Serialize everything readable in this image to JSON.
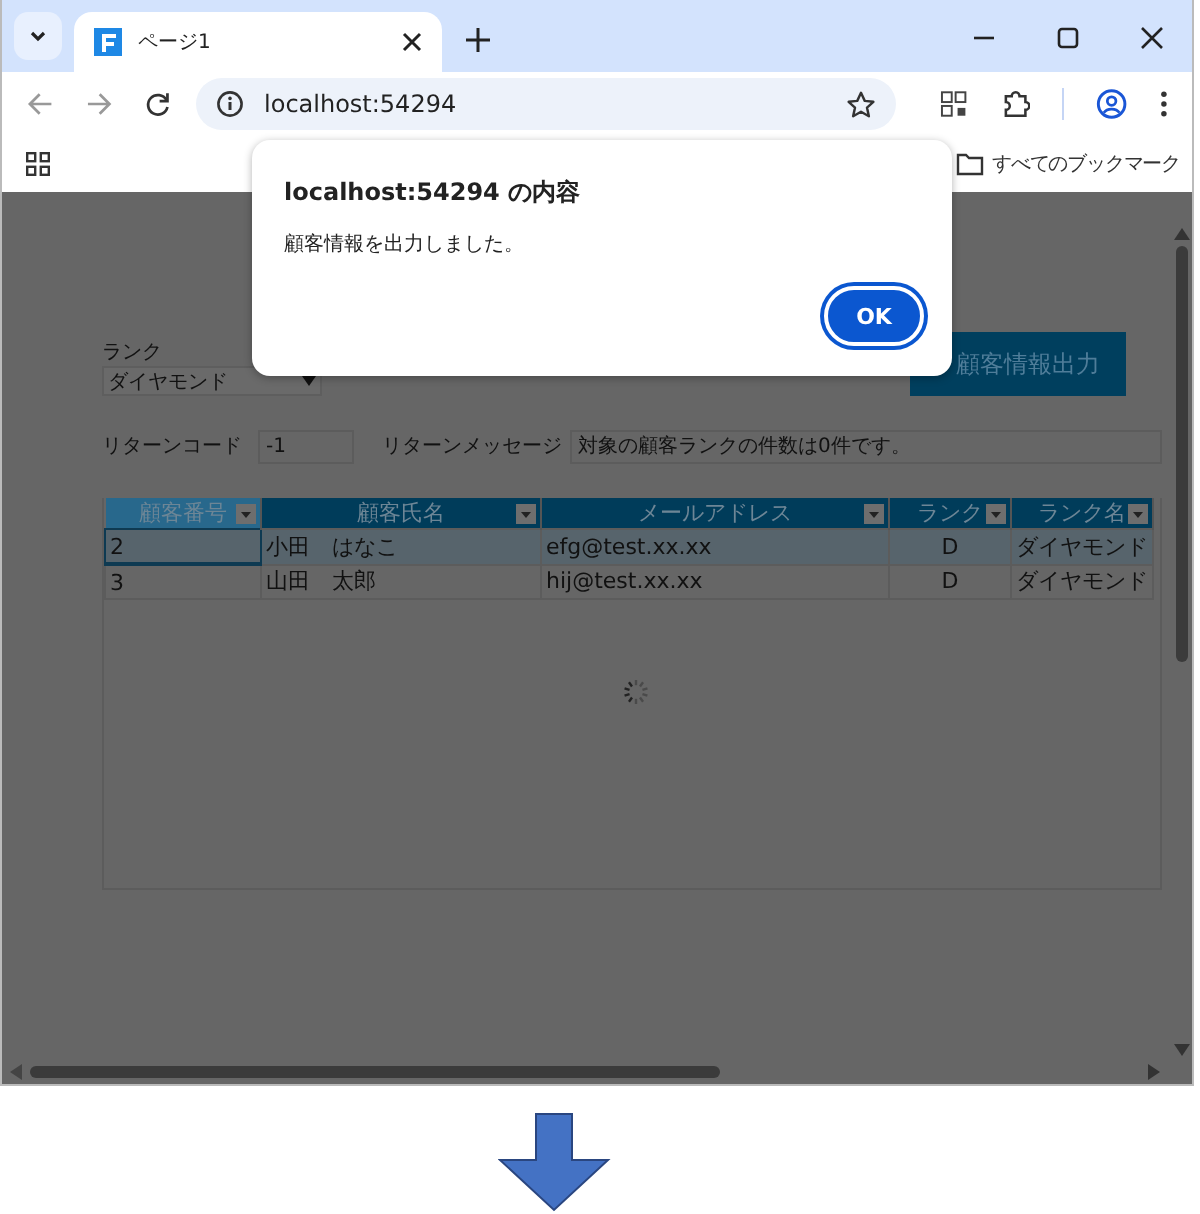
{
  "browser": {
    "tabs": [
      {
        "title": "ページ1",
        "selected": true
      }
    ],
    "address": "localhost:54294",
    "bookmarks": [
      {
        "label": "すべてのブックマーク"
      }
    ]
  },
  "page": {
    "rank": {
      "label": "ランク",
      "value": "ダイヤモンド"
    },
    "export_button": "顧客情報出力",
    "return_code": {
      "label": "リターンコード",
      "value": "-1"
    },
    "return_message": {
      "label": "リターンメッセージ",
      "value": "対象の顧客ランクの件数は0件です。"
    },
    "table": {
      "columns": [
        {
          "label": "顧客番号",
          "selected": true
        },
        {
          "label": "顧客氏名",
          "selected": false
        },
        {
          "label": "メールアドレス",
          "selected": false
        },
        {
          "label": "ランク",
          "selected": false
        },
        {
          "label": "ランク名",
          "selected": false
        }
      ],
      "rows": [
        {
          "cells": [
            "2",
            "小田　はなこ",
            "efg@test.xx.xx",
            "D",
            "ダイヤモンド"
          ],
          "selected": true
        },
        {
          "cells": [
            "3",
            "山田　太郎",
            "hij@test.xx.xx",
            "D",
            "ダイヤモンド"
          ],
          "selected": false
        }
      ]
    },
    "loading": true
  },
  "dialog": {
    "title": "localhost:54294 の内容",
    "message": "顧客情報を出力しました。",
    "button": "OK"
  }
}
